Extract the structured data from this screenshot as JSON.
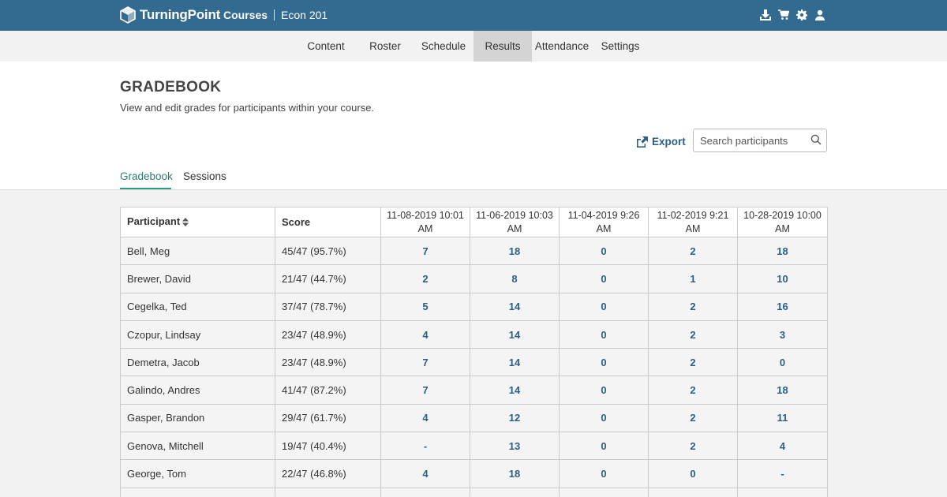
{
  "app": {
    "brand": "TurningPoint",
    "crumb_courses": "Courses",
    "crumb_course": "Econ 201"
  },
  "top_icons": [
    "download-icon",
    "cart-icon",
    "gear-icon",
    "user-icon"
  ],
  "nav": {
    "items": [
      {
        "label": "Content"
      },
      {
        "label": "Roster"
      },
      {
        "label": "Schedule"
      },
      {
        "label": "Results",
        "active": true
      },
      {
        "label": "Attendance"
      },
      {
        "label": "Settings"
      }
    ]
  },
  "page": {
    "title": "GRADEBOOK",
    "subtitle": "View and edit grades for participants within your course.",
    "export_label": "Export",
    "search_placeholder": "Search participants"
  },
  "tabs": [
    {
      "label": "Gradebook",
      "active": true
    },
    {
      "label": "Sessions"
    }
  ],
  "table": {
    "participant_header": "Participant",
    "score_header": "Score",
    "sessions": [
      {
        "date": "11-08-2019 10:01",
        "time": "AM"
      },
      {
        "date": "11-06-2019 10:03",
        "time": "AM"
      },
      {
        "date": "11-04-2019 9:26",
        "time": "AM"
      },
      {
        "date": "11-02-2019 9:21",
        "time": "AM"
      },
      {
        "date": "10-28-2019 10:00",
        "time": "AM"
      }
    ],
    "rows": [
      {
        "name": "Bell, Meg",
        "score": "45/47 (95.7%)",
        "values": [
          "7",
          "18",
          "0",
          "2",
          "18"
        ]
      },
      {
        "name": "Brewer, David",
        "score": "21/47 (44.7%)",
        "values": [
          "2",
          "8",
          "0",
          "1",
          "10"
        ]
      },
      {
        "name": "Cegelka, Ted",
        "score": "37/47 (78.7%)",
        "values": [
          "5",
          "14",
          "0",
          "2",
          "16"
        ]
      },
      {
        "name": "Czopur, Lindsay",
        "score": "23/47 (48.9%)",
        "values": [
          "4",
          "14",
          "0",
          "2",
          "3"
        ]
      },
      {
        "name": "Demetra, Jacob",
        "score": "23/47 (48.9%)",
        "values": [
          "7",
          "14",
          "0",
          "2",
          "0"
        ]
      },
      {
        "name": "Galindo, Andres",
        "score": "41/47 (87.2%)",
        "values": [
          "7",
          "14",
          "0",
          "2",
          "18"
        ]
      },
      {
        "name": "Gasper, Brandon",
        "score": "29/47 (61.7%)",
        "values": [
          "4",
          "12",
          "0",
          "2",
          "11"
        ]
      },
      {
        "name": "Genova, Mitchell",
        "score": "19/47 (40.4%)",
        "values": [
          "-",
          "13",
          "0",
          "2",
          "4"
        ]
      },
      {
        "name": "George, Tom",
        "score": "22/47 (46.8%)",
        "values": [
          "4",
          "18",
          "0",
          "0",
          "-"
        ]
      },
      {
        "name": "",
        "score": "",
        "values": [
          "",
          "",
          "",
          "",
          ""
        ]
      }
    ]
  },
  "colors": {
    "topbar": "#336a8f",
    "link": "#2d5f86",
    "tab_active": "#2c7c6e",
    "nav_active": "#d4d4d4"
  }
}
